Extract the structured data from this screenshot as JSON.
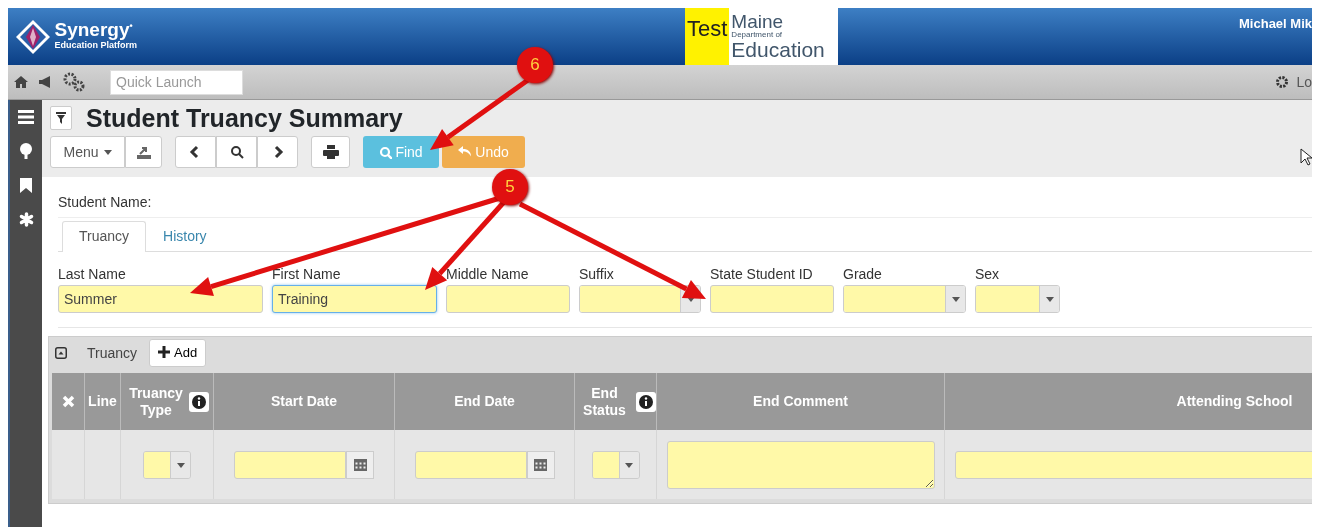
{
  "header": {
    "brand": "Synergy",
    "brand_mark": "•",
    "subtitle": "Education Platform",
    "org_badge": "Test",
    "org_lines": [
      "Maine",
      "Department of",
      "Education"
    ],
    "user": "Michael Mik"
  },
  "topbar": {
    "quick_launch": {
      "placeholder": "Quick Launch"
    },
    "right_text": "Lo"
  },
  "page": {
    "title": "Student Truancy Summary"
  },
  "toolbar": {
    "menu": "Menu",
    "find": "Find",
    "undo": "Undo"
  },
  "student_name_label": "Student Name:",
  "tabs": [
    {
      "label": "Truancy",
      "selected": true
    },
    {
      "label": "History",
      "selected": false
    }
  ],
  "fields": [
    {
      "label": "Last Name",
      "kind": "text",
      "value": "Summer",
      "focused": false
    },
    {
      "label": "First Name",
      "kind": "text",
      "value": "Training",
      "focused": true
    },
    {
      "label": "Middle Name",
      "kind": "text",
      "focused": false
    },
    {
      "label": "Suffix",
      "kind": "select",
      "focused": false
    },
    {
      "label": "State Student ID",
      "kind": "text",
      "focused": false
    },
    {
      "label": "Grade",
      "kind": "select",
      "focused": false
    },
    {
      "label": "Sex",
      "kind": "select",
      "focused": false
    }
  ],
  "grid": {
    "title": "Truancy",
    "add_button": "Add",
    "columns": [
      {
        "kind": "delete"
      },
      {
        "label": "Line",
        "kind": "plain"
      },
      {
        "label": "Truancy Type",
        "kind": "info"
      },
      {
        "label": "Start Date",
        "kind": "plain"
      },
      {
        "label": "End Date",
        "kind": "plain"
      },
      {
        "label": "End Status",
        "kind": "info"
      },
      {
        "label": "End Comment",
        "kind": "plain"
      },
      {
        "label": "Attending School",
        "kind": "plain"
      }
    ],
    "row": [
      {
        "kind": "empty"
      },
      {
        "kind": "empty"
      },
      {
        "kind": "select"
      },
      {
        "kind": "date"
      },
      {
        "kind": "date"
      },
      {
        "kind": "select"
      },
      {
        "kind": "textarea"
      },
      {
        "kind": "text"
      }
    ]
  },
  "callouts": [
    {
      "label": "6"
    },
    {
      "label": "5"
    }
  ]
}
